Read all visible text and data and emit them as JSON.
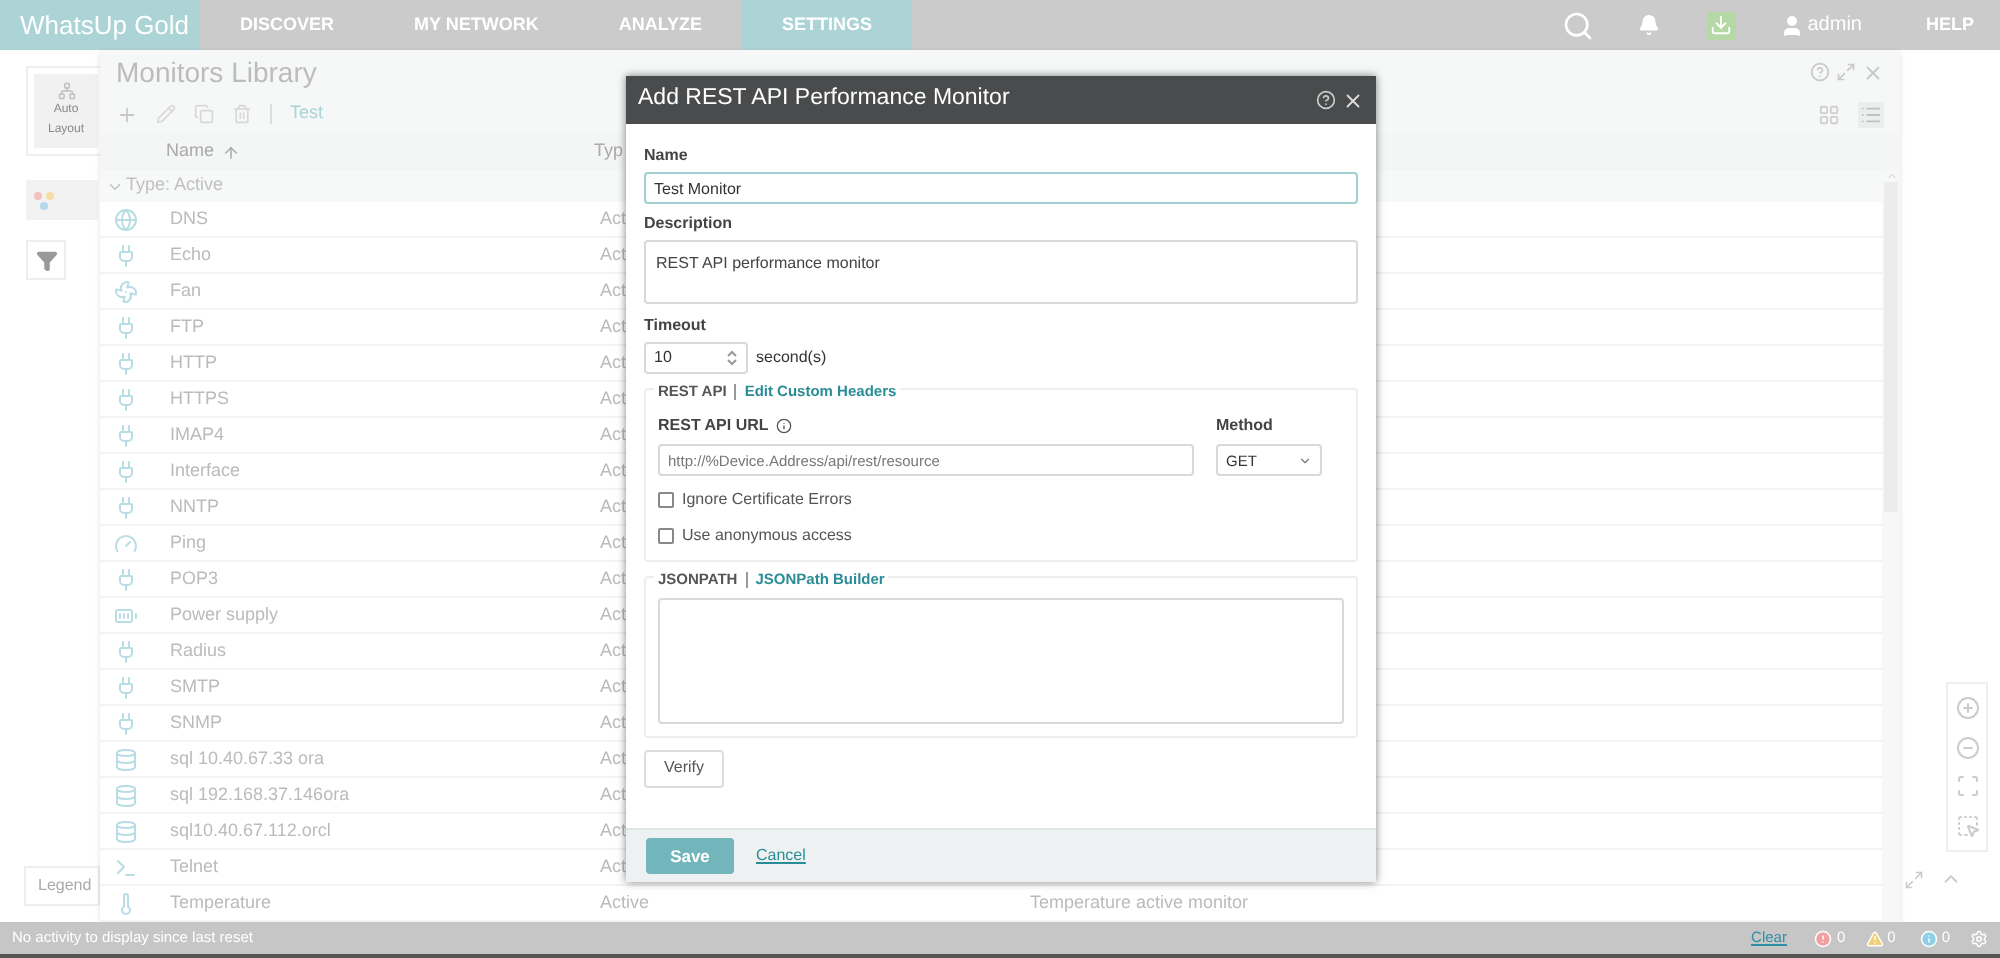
{
  "nav": {
    "logo": "WhatsUp Gold",
    "tabs": [
      {
        "label": "DISCOVER",
        "selected": false
      },
      {
        "label": "MY NETWORK",
        "selected": false
      },
      {
        "label": "ANALYZE",
        "selected": false
      },
      {
        "label": "SETTINGS",
        "selected": true
      }
    ],
    "user": "admin",
    "help": "HELP"
  },
  "sidebar": {
    "auto_layout": "Auto Layout",
    "legend": "Legend"
  },
  "library": {
    "title": "Monitors Library",
    "filter": "Test",
    "columns": [
      "Name",
      "Typ"
    ],
    "group": "Type: Active",
    "rows": [
      {
        "kind": "dns",
        "name": "DNS",
        "type": "Act"
      },
      {
        "kind": "plug",
        "name": "Echo",
        "type": "Act"
      },
      {
        "kind": "fan",
        "name": "Fan",
        "type": "Act"
      },
      {
        "kind": "plug",
        "name": "FTP",
        "type": "Act"
      },
      {
        "kind": "plug",
        "name": "HTTP",
        "type": "Act"
      },
      {
        "kind": "plug",
        "name": "HTTPS",
        "type": "Act"
      },
      {
        "kind": "plug",
        "name": "IMAP4",
        "type": "Act"
      },
      {
        "kind": "plug",
        "name": "Interface",
        "type": "Act"
      },
      {
        "kind": "plug",
        "name": "NNTP",
        "type": "Act"
      },
      {
        "kind": "ping",
        "name": "Ping",
        "type": "Act"
      },
      {
        "kind": "plug",
        "name": "POP3",
        "type": "Act"
      },
      {
        "kind": "power",
        "name": "Power supply",
        "type": "Act"
      },
      {
        "kind": "plug",
        "name": "Radius",
        "type": "Act"
      },
      {
        "kind": "plug",
        "name": "SMTP",
        "type": "Act"
      },
      {
        "kind": "plug",
        "name": "SNMP",
        "type": "Act"
      },
      {
        "kind": "db",
        "name": "sql 10.40.67.33 ora",
        "type": "Act"
      },
      {
        "kind": "db",
        "name": "sql 192.168.37.146ora",
        "type": "Act"
      },
      {
        "kind": "db",
        "name": "sql10.40.67.112.orcl",
        "type": "Act"
      },
      {
        "kind": "terminal",
        "name": "Telnet",
        "type": "Act"
      },
      {
        "kind": "thermo",
        "name": "Temperature",
        "type": "Active",
        "description": "Temperature active monitor"
      }
    ]
  },
  "dialog": {
    "title": "Add REST API Performance Monitor",
    "name_label": "Name",
    "name_value": "Test Monitor",
    "description_label": "Description",
    "description_value": "REST API performance monitor",
    "timeout_label": "Timeout",
    "timeout_value": "10",
    "timeout_unit": "second(s)",
    "rest_api": {
      "legend": "REST API",
      "link": "Edit Custom Headers",
      "url_label": "REST API URL",
      "url_placeholder": "http://%Device.Address/api/rest/resource",
      "method_label": "Method",
      "method_value": "GET",
      "checkboxes": [
        {
          "label": "Ignore Certificate Errors",
          "checked": false
        },
        {
          "label": "Use anonymous access",
          "checked": false
        }
      ]
    },
    "jsonpath": {
      "legend": "JSONPATH",
      "link": "JSONPath Builder"
    },
    "verify": "Verify",
    "save": "Save",
    "cancel": "Cancel"
  },
  "status": {
    "message": "No activity to display since last reset",
    "clear": "Clear",
    "counts": [
      "0",
      "0",
      "0"
    ]
  }
}
